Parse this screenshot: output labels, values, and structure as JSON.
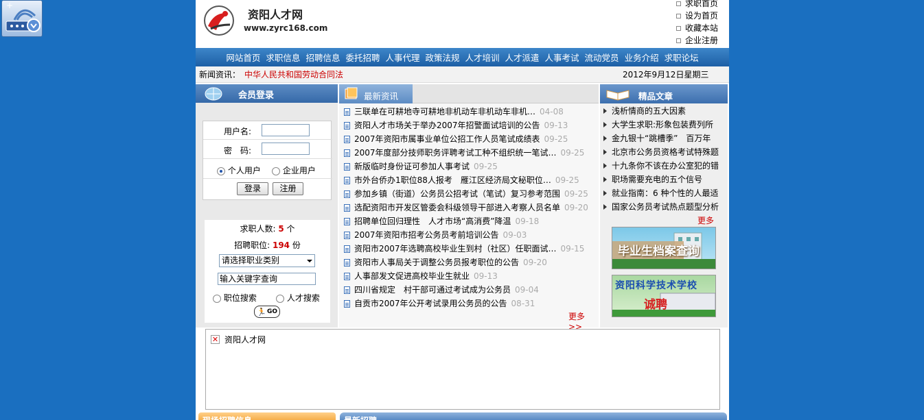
{
  "header": {
    "site_title": "资阳人才网",
    "site_url": "www.zyrc168.com",
    "top_links": [
      "求职首页",
      "设为首页",
      "收藏本站",
      "企业注册"
    ]
  },
  "nav": [
    "网站首页",
    "求职信息",
    "招聘信息",
    "委托招聘",
    "人事代理",
    "政策法规",
    "人才培训",
    "人才派遣",
    "人事考试",
    "流动党员",
    "业务介绍",
    "求职论坛"
  ],
  "newsbar": {
    "label": "新闻资讯：",
    "ticker": "中华人民共和国劳动合同法",
    "date": "2012年9月12日星期三"
  },
  "login": {
    "title": "会员登录",
    "username_label": "用户名:",
    "password_label": "密　码:",
    "radio_person": "个人用户",
    "radio_company": "企业用户",
    "login_button": "登录",
    "register_button": "注册"
  },
  "stats": {
    "seekers_label": "求职人数:",
    "seekers_value": "5",
    "seekers_unit": "个",
    "positions_label": "招聘职位:",
    "positions_value": "194",
    "positions_unit": "份",
    "category_select": "请选择职业类别",
    "keyword_value": "输入关键字查询",
    "search_position": "职位搜索",
    "search_talent": "人才搜索",
    "go_label": "GO"
  },
  "news": {
    "title": "最新资讯",
    "items": [
      {
        "title": "三联单在可耕地寺可耕地非机动车非机动车非机…",
        "date": "04-08"
      },
      {
        "title": "资阳人才市场关于举办2007年招警面试培训的公告",
        "date": "09-13"
      },
      {
        "title": "2007年资阳市属事业单位公招工作人员笔试成绩表",
        "date": "09-25"
      },
      {
        "title": "2007年度部分技师职务评聘考试工种不组织统一笔试…",
        "date": "09-25"
      },
      {
        "title": "新版临时身份证可参加人事考试",
        "date": "09-25"
      },
      {
        "title": "市外台侨办1职位88人报考　雁江区经济局文秘职位…",
        "date": "09-25"
      },
      {
        "title": "参加乡镇（街道）公务员公招考试（笔试）复习参考范围",
        "date": "09-25"
      },
      {
        "title": "选配资阳市开发区管委会科级领导干部进入考察人员名单",
        "date": "09-20"
      },
      {
        "title": "招聘单位回归理性　人才市场“高消费”降温",
        "date": "09-18"
      },
      {
        "title": "2007年资阳市招考公务员考前培训公告",
        "date": "09-03"
      },
      {
        "title": "资阳市2007年选聘高校毕业生到村（社区）任职面试…",
        "date": "09-15"
      },
      {
        "title": "资阳市人事局关于调整公务员报考职位的公告",
        "date": "09-20"
      },
      {
        "title": "人事部发文促进高校毕业生就业",
        "date": "09-13"
      },
      {
        "title": "四川省规定　村干部可通过考试成为公务员",
        "date": "09-04"
      },
      {
        "title": "自贡市2007年公开考试录用公务员的公告",
        "date": "08-31"
      }
    ],
    "more": "更多>>"
  },
  "articles": {
    "title": "精品文章",
    "items": [
      "浅析情商的五大因素",
      "大学生求职:形象包装费列所",
      "金九银十“跳槽季”　百万年",
      "北京市公务员资格考试特殊题",
      "十九条你不该在办公室犯的错",
      "职场需要充电的五个信号",
      "就业指南：6 种个性的人最适",
      "国家公务员考试热点题型分析"
    ],
    "more": "更多>>"
  },
  "banners": {
    "banner1": "毕业生档案查询",
    "banner2_line1": "资阳科学技术学校",
    "banner2_line2": "诚聘"
  },
  "friend_links": {
    "item": "资阳人才网"
  },
  "bottom_tabs": {
    "left": "现场招聘信息",
    "right": "最新招聘"
  }
}
